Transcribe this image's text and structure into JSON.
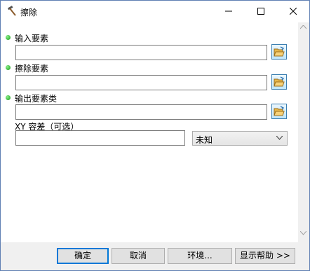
{
  "window": {
    "title": "擦除"
  },
  "params": [
    {
      "label": "输入要素",
      "value": ""
    },
    {
      "label": "擦除要素",
      "value": ""
    },
    {
      "label": "输出要素类",
      "value": ""
    }
  ],
  "xy_tolerance": {
    "label": "XY 容差（可选）",
    "value": "",
    "unit": "未知"
  },
  "buttons": {
    "ok": "确定",
    "cancel": "取消",
    "env": "环境...",
    "help": "显示帮助 >>"
  }
}
